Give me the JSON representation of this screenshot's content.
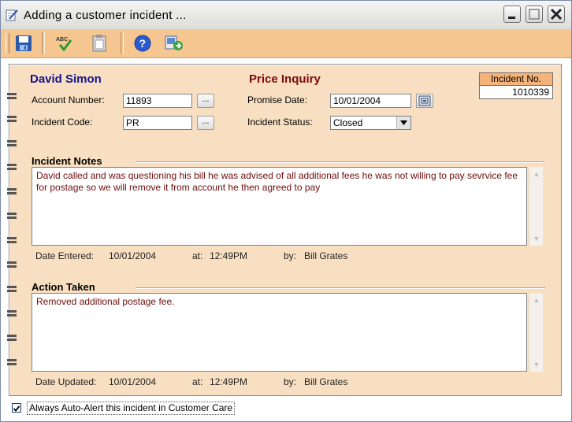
{
  "window": {
    "title": "Adding a customer incident ...",
    "controls": {
      "minimize": "minimize",
      "maximize": "maximize",
      "close": "close"
    }
  },
  "toolbar": {
    "buttons": [
      {
        "name": "save-icon",
        "tooltip": ""
      },
      {
        "name": "spellcheck-icon",
        "label": "ABC"
      },
      {
        "name": "clipboard-icon"
      },
      {
        "name": "help-icon",
        "glyph": "?"
      },
      {
        "name": "export-icon"
      }
    ]
  },
  "header": {
    "customer_name": "David Simon",
    "subject": "Price Inquiry",
    "incident_no_label": "Incident No.",
    "incident_no_value": "1010339"
  },
  "form": {
    "account_number_label": "Account Number:",
    "account_number_value": "11893",
    "incident_code_label": "Incident Code:",
    "incident_code_value": "PR",
    "lookup_button": "...",
    "promise_date_label": "Promise Date:",
    "promise_date_value": "10/01/2004",
    "incident_status_label": "Incident Status:",
    "incident_status_value": "Closed"
  },
  "notes": {
    "title": "Incident Notes",
    "text": "David called and was questioning his bill he was advised of all additional fees he was not willing to pay sevrvice fee for postage so we will remove it from account he then agreed to pay",
    "date_label": "Date Entered:",
    "date_value": "10/01/2004",
    "at_label": "at:",
    "time_value": "12:49PM",
    "by_label": "by:",
    "by_value": "Bill Grates"
  },
  "action": {
    "title": "Action Taken",
    "text": "Removed additional postage fee.",
    "date_label": "Date Updated:",
    "date_value": "10/01/2004",
    "at_label": "at:",
    "time_value": "12:49PM",
    "by_label": "by:",
    "by_value": "Bill Grates"
  },
  "footer": {
    "auto_alert_label": "Always Auto-Alert this incident in Customer Care",
    "auto_alert_checked": true
  },
  "colors": {
    "toolbar_bg": "#f5c690",
    "panel_bg": "#f8dfc1",
    "name_color": "#14148c",
    "subject_color": "#7c0c0c",
    "memo_text": "#6e0c0c"
  }
}
